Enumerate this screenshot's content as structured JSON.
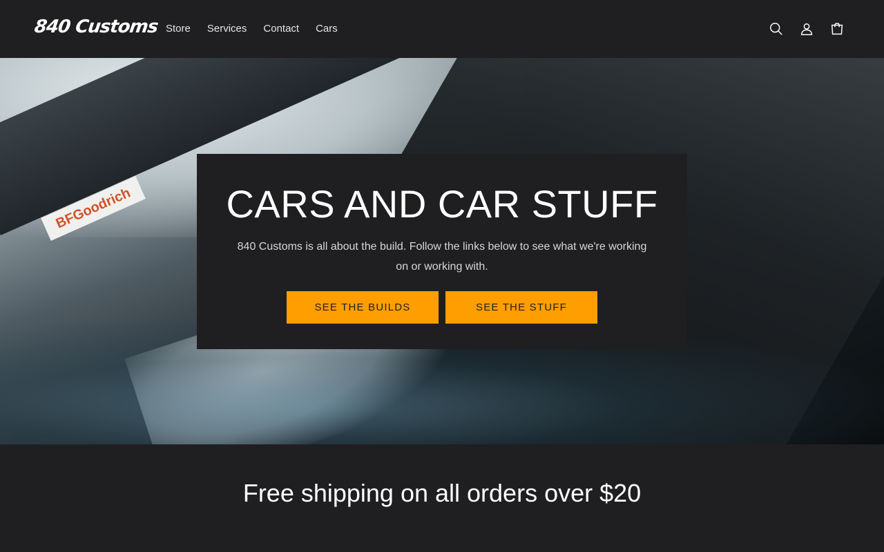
{
  "header": {
    "logo": "840 Customs",
    "nav": [
      "Store",
      "Services",
      "Contact",
      "Cars"
    ],
    "icons": [
      "search-icon",
      "account-icon",
      "cart-icon"
    ]
  },
  "hero": {
    "banner_text": "BFGoodrich",
    "title": "CARS AND CAR STUFF",
    "text": "840 Customs is all about the build. Follow the links below to see what we're working on or working with.",
    "buttons": [
      "SEE THE BUILDS",
      "SEE THE STUFF"
    ]
  },
  "shipping": {
    "text": "Free shipping on all orders over $20"
  },
  "colors": {
    "background": "#1f1f21",
    "accent": "#ff9e00",
    "text": "#ffffff"
  }
}
